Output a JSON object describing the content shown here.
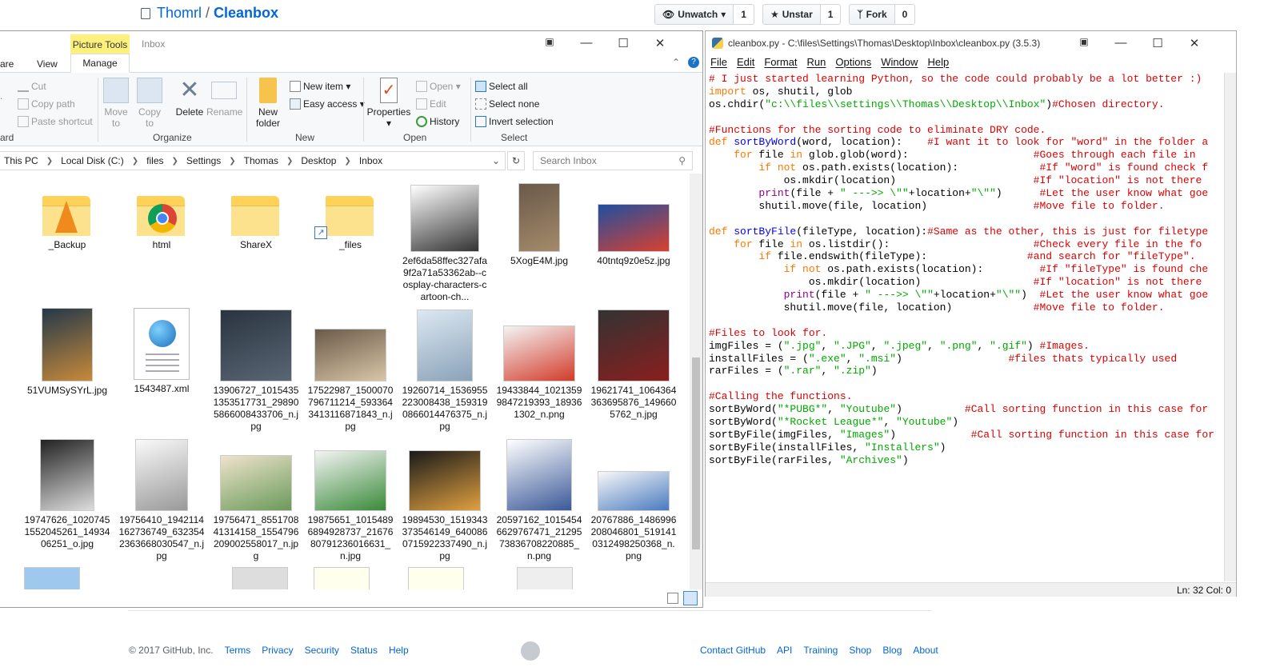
{
  "github": {
    "owner": "Thomrl",
    "separator": "/",
    "repo": "Cleanbox",
    "watch_label": "Unwatch",
    "watch_count": "1",
    "star_label": "Unstar",
    "star_count": "1",
    "fork_label": "Fork",
    "fork_count": "0"
  },
  "footer": {
    "copyright": "© 2017 GitHub, Inc.",
    "left_links": [
      "Terms",
      "Privacy",
      "Security",
      "Status",
      "Help"
    ],
    "right_links": [
      "Contact GitHub",
      "API",
      "Training",
      "Shop",
      "Blog",
      "About"
    ]
  },
  "explorer": {
    "context_tab": "Picture Tools",
    "title": "Inbox",
    "tabs": [
      "are",
      "View",
      "Manage"
    ],
    "clipboard": {
      "cut": "Cut",
      "copy_path": "Copy path",
      "paste_shortcut": "Paste shortcut",
      "left_edge": "ard"
    },
    "organize": {
      "move_to": "Move to",
      "copy_to": "Copy to",
      "delete": "Delete",
      "rename": "Rename",
      "label": "Organize"
    },
    "new": {
      "new_folder": "New folder",
      "new_item": "New item",
      "easy_access": "Easy access",
      "label": "New"
    },
    "open": {
      "properties": "Properties",
      "open": "Open",
      "edit": "Edit",
      "history": "History",
      "label": "Open"
    },
    "select": {
      "select_all": "Select all",
      "select_none": "Select none",
      "invert": "Invert selection",
      "label": "Select"
    },
    "path": [
      "This PC",
      "Local Disk (C:)",
      "files",
      "Settings",
      "Thomas",
      "Desktop",
      "Inbox"
    ],
    "search_placeholder": "Search Inbox",
    "files": [
      {
        "name": "_Backup",
        "kind": "folder-vlc"
      },
      {
        "name": "html",
        "kind": "folder-chrome"
      },
      {
        "name": "ShareX",
        "kind": "folder"
      },
      {
        "name": "_files",
        "kind": "folder-shortcut"
      },
      {
        "name": "2ef6da58ffec327afa9f2a71a53362ab--cosplay-characters-cartoon-ch...",
        "kind": "image-cartoon"
      },
      {
        "name": "5XogE4M.jpg",
        "kind": "image-photo"
      },
      {
        "name": "40tntq9z0e5z.jpg",
        "kind": "image-sport"
      },
      {
        "name": "51VUMSySYrL.jpg",
        "kind": "image-poster"
      },
      {
        "name": "1543487.xml",
        "kind": "xml"
      },
      {
        "name": "13906727_10154351353517731_298905866008433706_n.jpg",
        "kind": "image-dark"
      },
      {
        "name": "17522987_1500070796711214_5933643413116871843_n.jpg",
        "kind": "image-people"
      },
      {
        "name": "19260714_1536955223008438_1593190866014476375_n.jpg",
        "kind": "image-text"
      },
      {
        "name": "19433844_10213599847219393_189361302_n.png",
        "kind": "image-web"
      },
      {
        "name": "19621741_1064364363695876_1496605762_n.jpg",
        "kind": "image-car"
      },
      {
        "name": "19747626_10207451552045261_1493406251_o.jpg",
        "kind": "image-screen"
      },
      {
        "name": "19756410_1942114162736749_6323542363668030547_n.jpg",
        "kind": "image-list"
      },
      {
        "name": "19756471_855170841314158_1554796209002558017_n.jpg",
        "kind": "image-comic"
      },
      {
        "name": "19875651_10154896894928737_2167680791236016631_n.jpg",
        "kind": "image-comic2"
      },
      {
        "name": "19894530_1519343373546149_6400860715922337490_n.jpg",
        "kind": "image-gaming"
      },
      {
        "name": "20597162_10154546629767471_2129573836708220885_n.png",
        "kind": "image-tweet"
      },
      {
        "name": "20767886_1486996208046801_5191410312498250368_n.png",
        "kind": "image-heroes"
      }
    ]
  },
  "editor": {
    "title": "cleanbox.py - C:\\files\\Settings\\Thomas\\Desktop\\Inbox\\cleanbox.py (3.5.3)",
    "menu": [
      "File",
      "Edit",
      "Format",
      "Run",
      "Options",
      "Window",
      "Help"
    ],
    "status": "Ln: 32   Col: 0",
    "code_lines": [
      [
        [
          "c",
          "# I just started learning Python, so the code could probably be a lot better :)"
        ]
      ],
      [
        [
          "k",
          "import"
        ],
        [
          "",
          " os, shutil, glob"
        ]
      ],
      [
        [
          "",
          "os.chdir("
        ],
        [
          "s",
          "\"c:\\\\files\\\\settings\\\\Thomas\\\\Desktop\\\\Inbox\""
        ],
        [
          "",
          ")"
        ],
        [
          "c",
          "#Chosen directory."
        ]
      ],
      [
        [
          "",
          ""
        ]
      ],
      [
        [
          "c",
          "#Functions for the sorting code to eliminate DRY code."
        ]
      ],
      [
        [
          "k",
          "def"
        ],
        [
          "",
          " "
        ],
        [
          "d",
          "sortByWord"
        ],
        [
          "",
          "(word, location):    "
        ],
        [
          "c",
          "#I want it to look for \"word\" in the folder a"
        ]
      ],
      [
        [
          "",
          "    "
        ],
        [
          "k",
          "for"
        ],
        [
          "",
          " file "
        ],
        [
          "k",
          "in"
        ],
        [
          "",
          " glob.glob(word):                    "
        ],
        [
          "c",
          "#Goes through each file in"
        ]
      ],
      [
        [
          "",
          "        "
        ],
        [
          "k",
          "if not"
        ],
        [
          "",
          " os.path.exists(location):             "
        ],
        [
          "c",
          "#If \"word\" is found check f"
        ]
      ],
      [
        [
          "",
          "            os.mkdir(location)                      "
        ],
        [
          "c",
          "#If \"location\" is not there"
        ]
      ],
      [
        [
          "",
          "        "
        ],
        [
          "b",
          "print"
        ],
        [
          "",
          "(file + "
        ],
        [
          "s",
          "\" --->> \\\"\""
        ],
        [
          "",
          "+location+"
        ],
        [
          "s",
          "\"\\\"\""
        ],
        [
          "",
          ")      "
        ],
        [
          "c",
          "#Let the user know what goe"
        ]
      ],
      [
        [
          "",
          "        shutil.move(file, location)                 "
        ],
        [
          "c",
          "#Move file to folder."
        ]
      ],
      [
        [
          "",
          ""
        ]
      ],
      [
        [
          "k",
          "def"
        ],
        [
          "",
          " "
        ],
        [
          "d",
          "sortByFile"
        ],
        [
          "",
          "(fileType, location):"
        ],
        [
          "c",
          "#Same as the other, this is just for filetype"
        ]
      ],
      [
        [
          "",
          "    "
        ],
        [
          "k",
          "for"
        ],
        [
          "",
          " file "
        ],
        [
          "k",
          "in"
        ],
        [
          "",
          " os.listdir():                       "
        ],
        [
          "c",
          "#Check every file in the fo"
        ]
      ],
      [
        [
          "",
          "        "
        ],
        [
          "k",
          "if"
        ],
        [
          "",
          " file.endswith(fileType):                "
        ],
        [
          "c",
          "#and search for \"fileType\"."
        ]
      ],
      [
        [
          "",
          "            "
        ],
        [
          "k",
          "if not"
        ],
        [
          "",
          " os.path.exists(location):         "
        ],
        [
          "c",
          "#If \"fileType\" is found che"
        ]
      ],
      [
        [
          "",
          "                os.mkdir(location)                  "
        ],
        [
          "c",
          "#If \"location\" is not there"
        ]
      ],
      [
        [
          "",
          "            "
        ],
        [
          "b",
          "print"
        ],
        [
          "",
          "(file + "
        ],
        [
          "s",
          "\" --->> \\\"\""
        ],
        [
          "",
          "+location+"
        ],
        [
          "s",
          "\"\\\"\""
        ],
        [
          "",
          ")  "
        ],
        [
          "c",
          "#Let the user know what goe"
        ]
      ],
      [
        [
          "",
          "            shutil.move(file, location)             "
        ],
        [
          "c",
          "#Move file to folder."
        ]
      ],
      [
        [
          "",
          ""
        ]
      ],
      [
        [
          "c",
          "#Files to look for."
        ]
      ],
      [
        [
          "",
          "imgFiles = ("
        ],
        [
          "s",
          "\".jpg\""
        ],
        [
          "",
          ", "
        ],
        [
          "s",
          "\".JPG\""
        ],
        [
          "",
          ", "
        ],
        [
          "s",
          "\".jpeg\""
        ],
        [
          "",
          ", "
        ],
        [
          "s",
          "\".png\""
        ],
        [
          "",
          ", "
        ],
        [
          "s",
          "\".gif\""
        ],
        [
          "",
          ") "
        ],
        [
          "c",
          "#Images."
        ]
      ],
      [
        [
          "",
          "installFiles = ("
        ],
        [
          "s",
          "\".exe\""
        ],
        [
          "",
          ", "
        ],
        [
          "s",
          "\".msi\""
        ],
        [
          "",
          ")                 "
        ],
        [
          "c",
          "#files thats typically used"
        ]
      ],
      [
        [
          "",
          "rarFiles = ("
        ],
        [
          "s",
          "\".rar\""
        ],
        [
          "",
          ", "
        ],
        [
          "s",
          "\".zip\""
        ],
        [
          "",
          ")"
        ]
      ],
      [
        [
          "",
          ""
        ]
      ],
      [
        [
          "c",
          "#Calling the functions."
        ]
      ],
      [
        [
          "",
          "sortByWord("
        ],
        [
          "s",
          "\"*PUBG*\""
        ],
        [
          "",
          ", "
        ],
        [
          "s",
          "\"Youtube\""
        ],
        [
          "",
          ")          "
        ],
        [
          "c",
          "#Call sorting function in this case for"
        ]
      ],
      [
        [
          "",
          "sortByWord("
        ],
        [
          "s",
          "\"*Rocket League*\""
        ],
        [
          "",
          ", "
        ],
        [
          "s",
          "\"Youtube\""
        ],
        [
          "",
          ")"
        ]
      ],
      [
        [
          "",
          "sortByFile(imgFiles, "
        ],
        [
          "s",
          "\"Images\""
        ],
        [
          "",
          ")            "
        ],
        [
          "c",
          "#Call sorting function in this case for"
        ]
      ],
      [
        [
          "",
          "sortByFile(installFiles, "
        ],
        [
          "s",
          "\"Installers\""
        ],
        [
          "",
          ")"
        ]
      ],
      [
        [
          "",
          "sortByFile(rarFiles, "
        ],
        [
          "s",
          "\"Archives\""
        ],
        [
          "",
          ")"
        ]
      ]
    ]
  }
}
